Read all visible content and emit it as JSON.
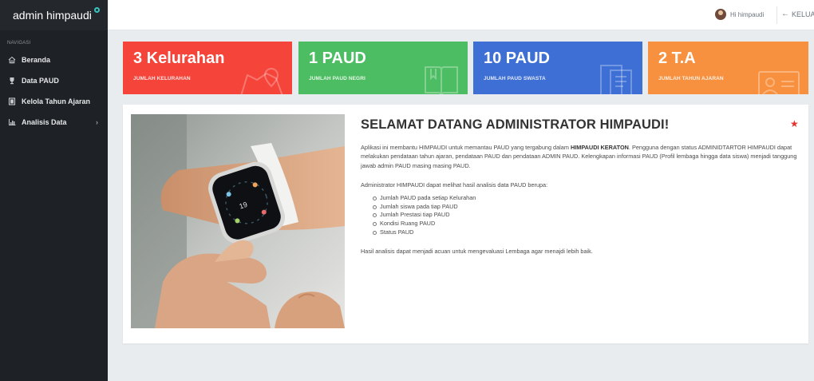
{
  "brand": {
    "name": "admin himpaudi"
  },
  "sidebar": {
    "heading": "NAVIGASI",
    "items": [
      {
        "label": "Beranda",
        "icon": "home-icon"
      },
      {
        "label": "Data PAUD",
        "icon": "trophy-icon"
      },
      {
        "label": "Kelola Tahun Ajaran",
        "icon": "calendar-icon"
      },
      {
        "label": "Analisis Data",
        "icon": "bar-chart-icon",
        "has_submenu": true
      }
    ]
  },
  "topbar": {
    "greeting": "Hi himpaudi",
    "logout_label": "KELUAR"
  },
  "stats": [
    {
      "value": "3 Kelurahan",
      "label": "JUMLAH KELURAHAN",
      "color": "#f5443a",
      "icon": "map-icon"
    },
    {
      "value": "1 PAUD",
      "label": "JUMLAH PAUD NEGRI",
      "color": "#4cbd62",
      "icon": "book-icon"
    },
    {
      "value": "10 PAUD",
      "label": "JUMLAH PAUD SWASTA",
      "color": "#3d6fd4",
      "icon": "document-icon"
    },
    {
      "value": "2 T.A",
      "label": "JUMLAH TAHUN AJARAN",
      "color": "#f8913f",
      "icon": "id-card-icon"
    }
  ],
  "welcome": {
    "title": "SELAMAT DATANG ADMINISTRATOR HIMPAUDI!",
    "para1_before": "Aplikasi ini membantu HIMPAUDI untuk memantau PAUD yang tergabung dalam ",
    "para1_bold": "HIMPAUDI KERATON",
    "para1_after": ". Pengguna dengan status ADMINIDTARTOR HIMPAUDI dapat melakukan pendataan tahun ajaran, pendataan PAUD dan pendataan ADMIN PAUD. Kelengkapan informasi PAUD (Profil lembaga hingga data siswa) menjadi tanggung jawab admin PAUD masing masing PAUD.",
    "para2": "Administrator HIMPAUDI dapat melihat hasil analisis data PAUD berupa:",
    "list": [
      "Jumlah PAUD pada setiap Kelurahan",
      "Jumlah siswa pada tiap PAUD",
      "Jumlah Prestasi tiap PAUD",
      "Kondisi Ruang PAUD",
      "Status PAUD"
    ],
    "para3": "Hasil analisis dapat menjadi acuan untuk mengevaluasi Lembaga agar menajdi lebih baik."
  },
  "colors": {
    "sidebar": "#1e2125",
    "accent": "#35c6c0",
    "star": "#e8312a"
  }
}
